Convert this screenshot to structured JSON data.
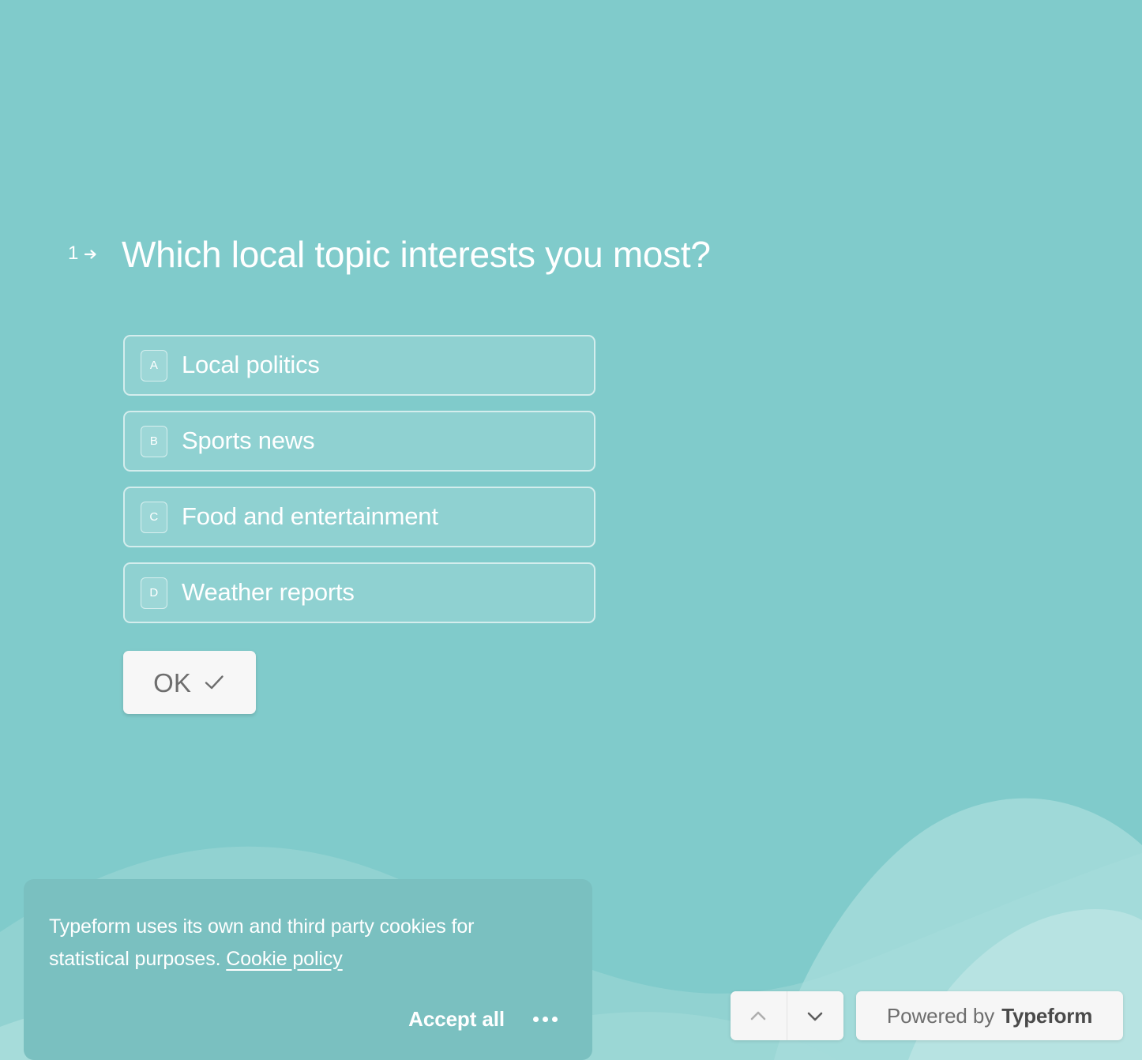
{
  "theme": {
    "background_color": "#80CBCB",
    "wave_light_color": "#9ED9D7",
    "wave_lighter_color": "#B4E2E0",
    "banner_color": "#7AC0C0",
    "button_surface_color": "#F6F6F6",
    "text_on_background": "#FFFFFF",
    "muted_text_color": "#6E6E6E"
  },
  "question": {
    "number": "1",
    "arrow_icon": "arrow-right-icon",
    "title": "Which local topic interests you most?",
    "options": [
      {
        "key": "A",
        "label": "Local politics"
      },
      {
        "key": "B",
        "label": "Sports news"
      },
      {
        "key": "C",
        "label": "Food and entertainment"
      },
      {
        "key": "D",
        "label": "Weather reports"
      }
    ],
    "submit": {
      "label": "OK",
      "icon": "check-icon"
    }
  },
  "cookie_banner": {
    "message_before_link": "Typeform uses its own and third party cookies for statistical purposes. ",
    "link_label": "Cookie policy",
    "accept_label": "Accept all",
    "more_options_icon": "ellipsis-icon"
  },
  "navigation": {
    "prev_icon": "chevron-up-icon",
    "next_icon": "chevron-down-icon",
    "prev_enabled": false,
    "next_enabled": true
  },
  "branding": {
    "prefix": "Powered by",
    "brand": "Typeform"
  }
}
